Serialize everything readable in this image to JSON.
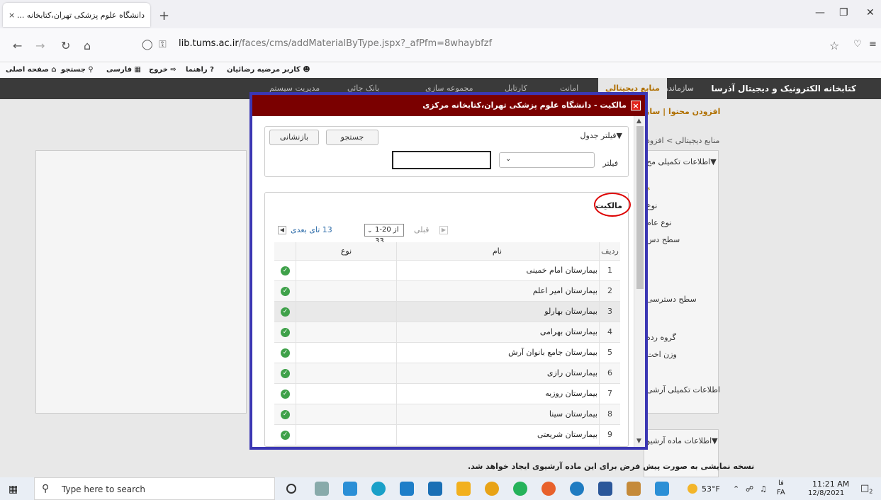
{
  "browser": {
    "tab_title": "دانشگاه علوم پزشکی تهران،کتابخانه ...",
    "tab_close": "×",
    "new_tab": "+",
    "url_host": "lib.tums.ac.ir",
    "url_path": "/faces/cms/addMaterialByType.jspx?_afPfm=8whaybfzf",
    "bookmarks": [
      {
        "label": "صفحه اصلی",
        "icon": "home-icon"
      },
      {
        "label": "جستجو",
        "icon": "search-icon"
      },
      {
        "label": "فارسی",
        "icon": "language-icon"
      },
      {
        "label": "خروج",
        "icon": "exit-icon"
      },
      {
        "label": "راهنما",
        "icon": "help-icon"
      },
      {
        "label": "کاربر مرضیه رضائیان",
        "icon": "user-icon"
      }
    ]
  },
  "site": {
    "title": "کتابخانه الکترونیک و دیجیتال آذرسا",
    "menu": [
      "سازماندهی",
      "منابع دیجیتالی",
      "امانت",
      "کارتابل",
      "مجموعه سازی",
      "بانک جائی",
      "مدیریت سیستم"
    ],
    "submenu": "افزودن محتوا | ساز",
    "breadcrumb": "منابع دیجیتالی > افزود",
    "side_labels": [
      "▼اطلاعات تکمیلی مح",
      "نوع",
      "نوع عام",
      "سطح دس",
      "سطح دسترسی",
      "گروه رده",
      "وزن اخت",
      "اطلاعات تکمیلی آرشی",
      "▼اطلاعات ماده آرشیو"
    ],
    "bottom_note": "نسخه نمایشی به صورت پیش فرض برای این ماده آرشیوی ایجاد خواهد شد."
  },
  "modal": {
    "title": "مالکیت - دانشگاه علوم پزشکی تهران،کتابخانه مرکزی",
    "close": "×",
    "filter": {
      "section_title": "▼فیلتر جدول",
      "search_button": "جستجو",
      "reset_button": "بازنشانی",
      "label": "فیلتر",
      "input_value": ""
    },
    "table": {
      "section_title": "مالکیت",
      "pager": {
        "prev": "قبلی",
        "range": "1-20 از 33",
        "next": "13 تای بعدی"
      },
      "headers": {
        "num": "ردیف",
        "name": "نام",
        "type": "نوع"
      },
      "rows": [
        {
          "num": "1",
          "name": "بیمارستان امام خمینی",
          "type": ""
        },
        {
          "num": "2",
          "name": "بیمارستان امیر اعلم",
          "type": ""
        },
        {
          "num": "3",
          "name": "بیمارستان بهارلو",
          "type": ""
        },
        {
          "num": "4",
          "name": "بیمارستان بهرامی",
          "type": ""
        },
        {
          "num": "5",
          "name": "بیمارستان جامع بانوان آرش",
          "type": ""
        },
        {
          "num": "6",
          "name": "بیمارستان رازی",
          "type": ""
        },
        {
          "num": "7",
          "name": "بیمارستان روزبه",
          "type": ""
        },
        {
          "num": "8",
          "name": "بیمارستان سینا",
          "type": ""
        },
        {
          "num": "9",
          "name": "بیمارستان شریعتی",
          "type": ""
        }
      ]
    }
  },
  "taskbar": {
    "search_placeholder": "Type here to search",
    "weather": "53°F",
    "lang_top": "فا",
    "lang": "FA",
    "time": "11:21 AM",
    "date": "12/8/2021",
    "notification_count": "2"
  },
  "colors": {
    "modal_header": "#7a0000",
    "modal_outline": "#3b37b3",
    "annotation_circle": "#dd0000",
    "check_green": "#3fa14a",
    "site_header": "#3a3a3a"
  }
}
